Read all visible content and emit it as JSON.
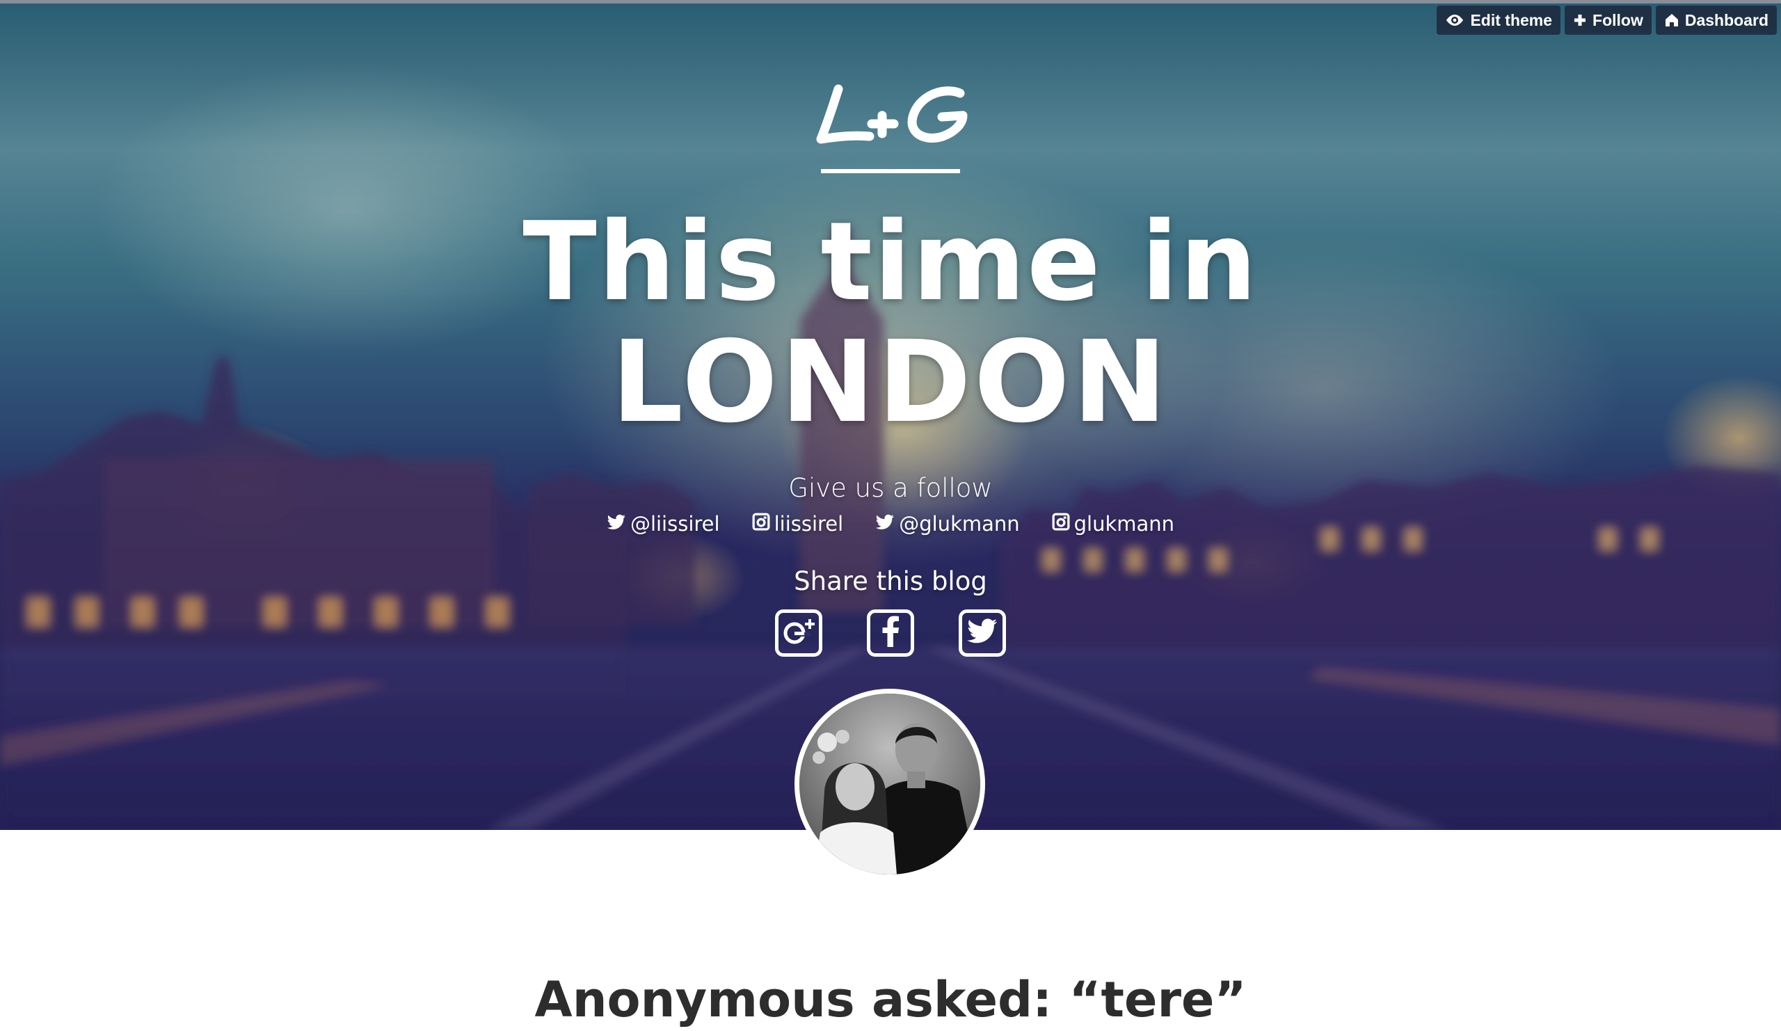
{
  "toolbar": {
    "buttons": [
      {
        "label": "Edit theme",
        "icon": "eye-icon"
      },
      {
        "label": "Follow",
        "icon": "plus-icon"
      },
      {
        "label": "Dashboard",
        "icon": "home-icon"
      }
    ]
  },
  "header": {
    "logo_text": "L+G",
    "title_line1": "This time in",
    "title_line2": "LONDON"
  },
  "follow": {
    "heading": "Give us a follow",
    "links": [
      {
        "network": "twitter-icon",
        "handle": "@liissirel"
      },
      {
        "network": "instagram-icon",
        "handle": "liissirel"
      },
      {
        "network": "twitter-icon",
        "handle": "@glukmann"
      },
      {
        "network": "instagram-icon",
        "handle": "glukmann"
      }
    ]
  },
  "share": {
    "heading": "Share this blog",
    "buttons": [
      "google-plus-icon",
      "facebook-icon",
      "twitter-icon"
    ]
  },
  "post": {
    "title": "Anonymous asked: “tere”"
  },
  "colors": {
    "hero_top": "#2f6a7d",
    "hero_bottom": "#2a2a5e",
    "button_bg": "#1c263a",
    "post_text": "#2d2d2d"
  }
}
